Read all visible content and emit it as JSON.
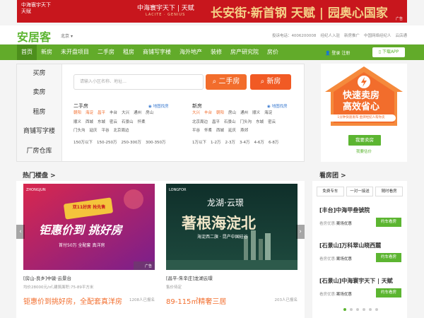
{
  "banner": {
    "left_line1": "中海寰宇天下",
    "left_line2": "天赋",
    "mid": "中海寰宇天下 | 天赋",
    "mid_sub": "LACITE · GENIUS",
    "headline": "长安街·新首钢  天赋 | 园奥心国家",
    "ad": "广告"
  },
  "header": {
    "logo": "安居客",
    "city": "北京",
    "links": [
      "投诉电话：4006200008",
      "经纪人入驻",
      "新房推广",
      "中国网络经纪人",
      "云店通"
    ]
  },
  "nav": {
    "items": [
      "首页",
      "新房",
      "未开盘项目",
      "二手房",
      "租房",
      "商铺写字楼",
      "海外地产",
      "装修",
      "房产研究院",
      "房价"
    ],
    "user": "登录  注册",
    "download": "下载APP"
  },
  "search": {
    "sidebar": [
      "买房",
      "卖房",
      "租房",
      "商铺写字楼",
      "厂房仓库"
    ],
    "placeholder": "请输入小区名称、地址…",
    "btn_second": "二手房",
    "btn_new": "新房",
    "second": {
      "title": "二手房",
      "map": "地图找房",
      "row1": [
        "朝阳",
        "海淀",
        "昌平",
        "丰台",
        "大兴",
        "通州",
        "房山"
      ],
      "row2": [
        "顺义",
        "西城",
        "东城",
        "密云",
        "石景山",
        "怀柔"
      ],
      "row3": [
        "门头沟",
        "延庆",
        "平谷",
        "北京周边"
      ],
      "price": [
        "150万以下",
        "150-250万",
        "250-300万",
        "300-350万"
      ]
    },
    "newhouse": {
      "title": "新房",
      "map": "地图找房",
      "row1": [
        "大兴",
        "丰台",
        "朝阳",
        "房山",
        "通州",
        "顺义",
        "海淀"
      ],
      "row2": [
        "北京周边",
        "昌平",
        "石景山",
        "门头沟",
        "东城",
        "密云"
      ],
      "row3": [
        "平谷",
        "怀柔",
        "西城",
        "延庆",
        "燕郊"
      ],
      "price": [
        "1万以下",
        "1-2万",
        "2-3万",
        "3-4万",
        "4-6万",
        "6-8万"
      ]
    }
  },
  "promo": {
    "line1": "快速卖房",
    "line2": "高效省心",
    "sub": "1分钟快速发布 金牌经纪人帮你卖",
    "btn": "我要卖房",
    "link": "我要估价"
  },
  "hot": {
    "title": "热门楼盘 >",
    "cards": [
      {
        "name": "[房山-良乡]中骏·云景台",
        "meta": "均价28000元/㎡,建筑面积:75-89平方米",
        "price": "钜惠价到挑好房，全配套真洋房",
        "count": "1208人已报名",
        "img_title": "钜惠价到 挑好房",
        "img_tag": "双11好房 抢先售",
        "img_sub": "首付50万 全配套 真洋房"
      },
      {
        "name": "[昌平-朱辛庄]龙湖云璟",
        "meta": "售价待定",
        "price": "89-115㎡精奢三居",
        "count": "203人已报名",
        "img_brand": "龙湖·云璟",
        "img_title": "著根海淀北",
        "img_sub": "海淀西二旗 · 昆产中国硅谷",
        "img_logo": "LONGFOR"
      }
    ]
  },
  "tuan": {
    "title": "看房团 >",
    "tabs": [
      "免费专车",
      "一对一接送",
      "随时看房"
    ],
    "items": [
      {
        "title": "[丰台]中海甲叁號院",
        "status_label": "看房优惠:",
        "status": "案场优惠",
        "btn": "约车看房"
      },
      {
        "title": "[石景山]万科翠山晓西麓",
        "status_label": "看房优惠:",
        "status": "案场优惠",
        "btn": "约车看房"
      },
      {
        "title": "[石景山]中海寰宇天下 | 天赋",
        "status_label": "看房优惠:",
        "status": "案场优惠",
        "btn": "约车看房"
      }
    ]
  },
  "colors": {
    "brand_green": "#5cb531",
    "nav_green": "#62ab2a",
    "accent_orange": "#f26d2c",
    "banner_red": "#c8161d"
  }
}
